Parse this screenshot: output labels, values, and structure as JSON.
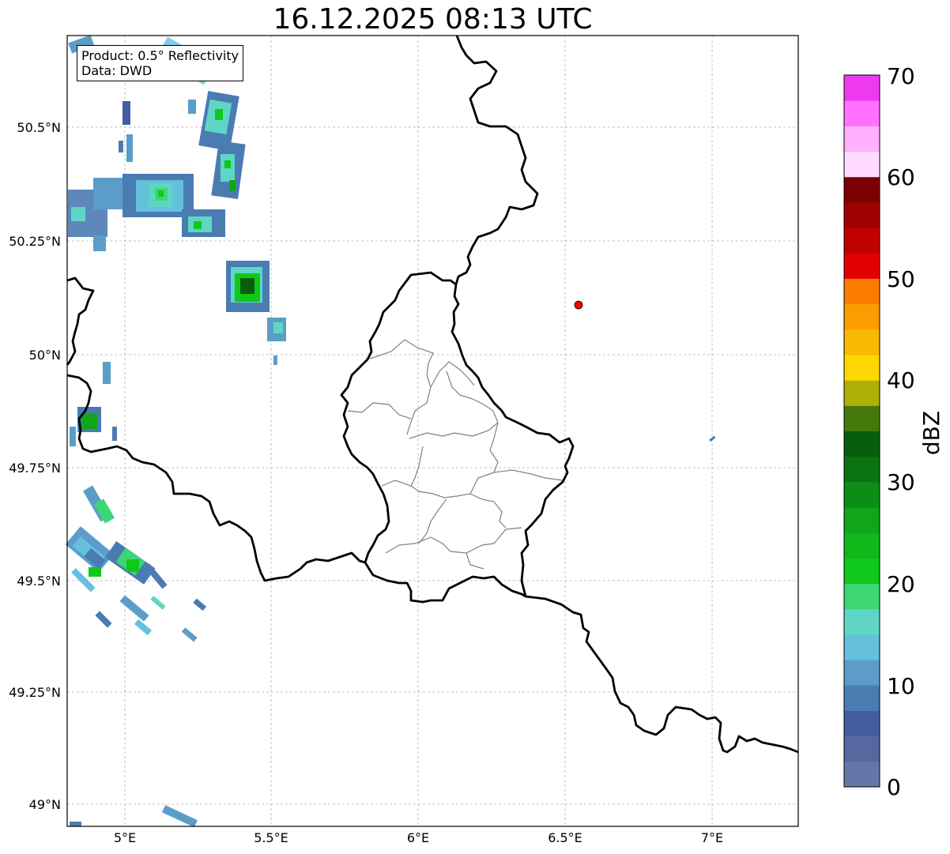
{
  "title": "16.12.2025 08:13 UTC",
  "info": {
    "product": "Product: 0.5° Reflectivity",
    "data_source": "Data: DWD"
  },
  "axes": {
    "lat_labels": [
      "50.5°N",
      "50.25°N",
      "50°N",
      "49.75°N",
      "49.5°N",
      "49.25°N",
      "49°N"
    ],
    "lon_labels": [
      "5°E",
      "5.5°E",
      "6°E",
      "6.5°E",
      "7°E"
    ]
  },
  "colorbar": {
    "label": "dBZ",
    "ticks": [
      "0",
      "10",
      "20",
      "30",
      "40",
      "50",
      "60",
      "70"
    ],
    "colors": [
      "#6576a8",
      "#5569a0",
      "#435e9e",
      "#4a7cb2",
      "#5b9dc8",
      "#64c0dc",
      "#5fd6c4",
      "#3dd674",
      "#10c81a",
      "#10b81a",
      "#10a51a",
      "#0c8e16",
      "#0a7412",
      "#085e0c",
      "#447a0a",
      "#adb105",
      "#fcd800",
      "#fbb800",
      "#fb9d00",
      "#fa7d00",
      "#e40000",
      "#c10000",
      "#a10000",
      "#7b0000",
      "#ffdcff",
      "#ffb0ff",
      "#ff70ff",
      "#ee3aee"
    ]
  },
  "marker": {
    "color": "#ff0000"
  }
}
